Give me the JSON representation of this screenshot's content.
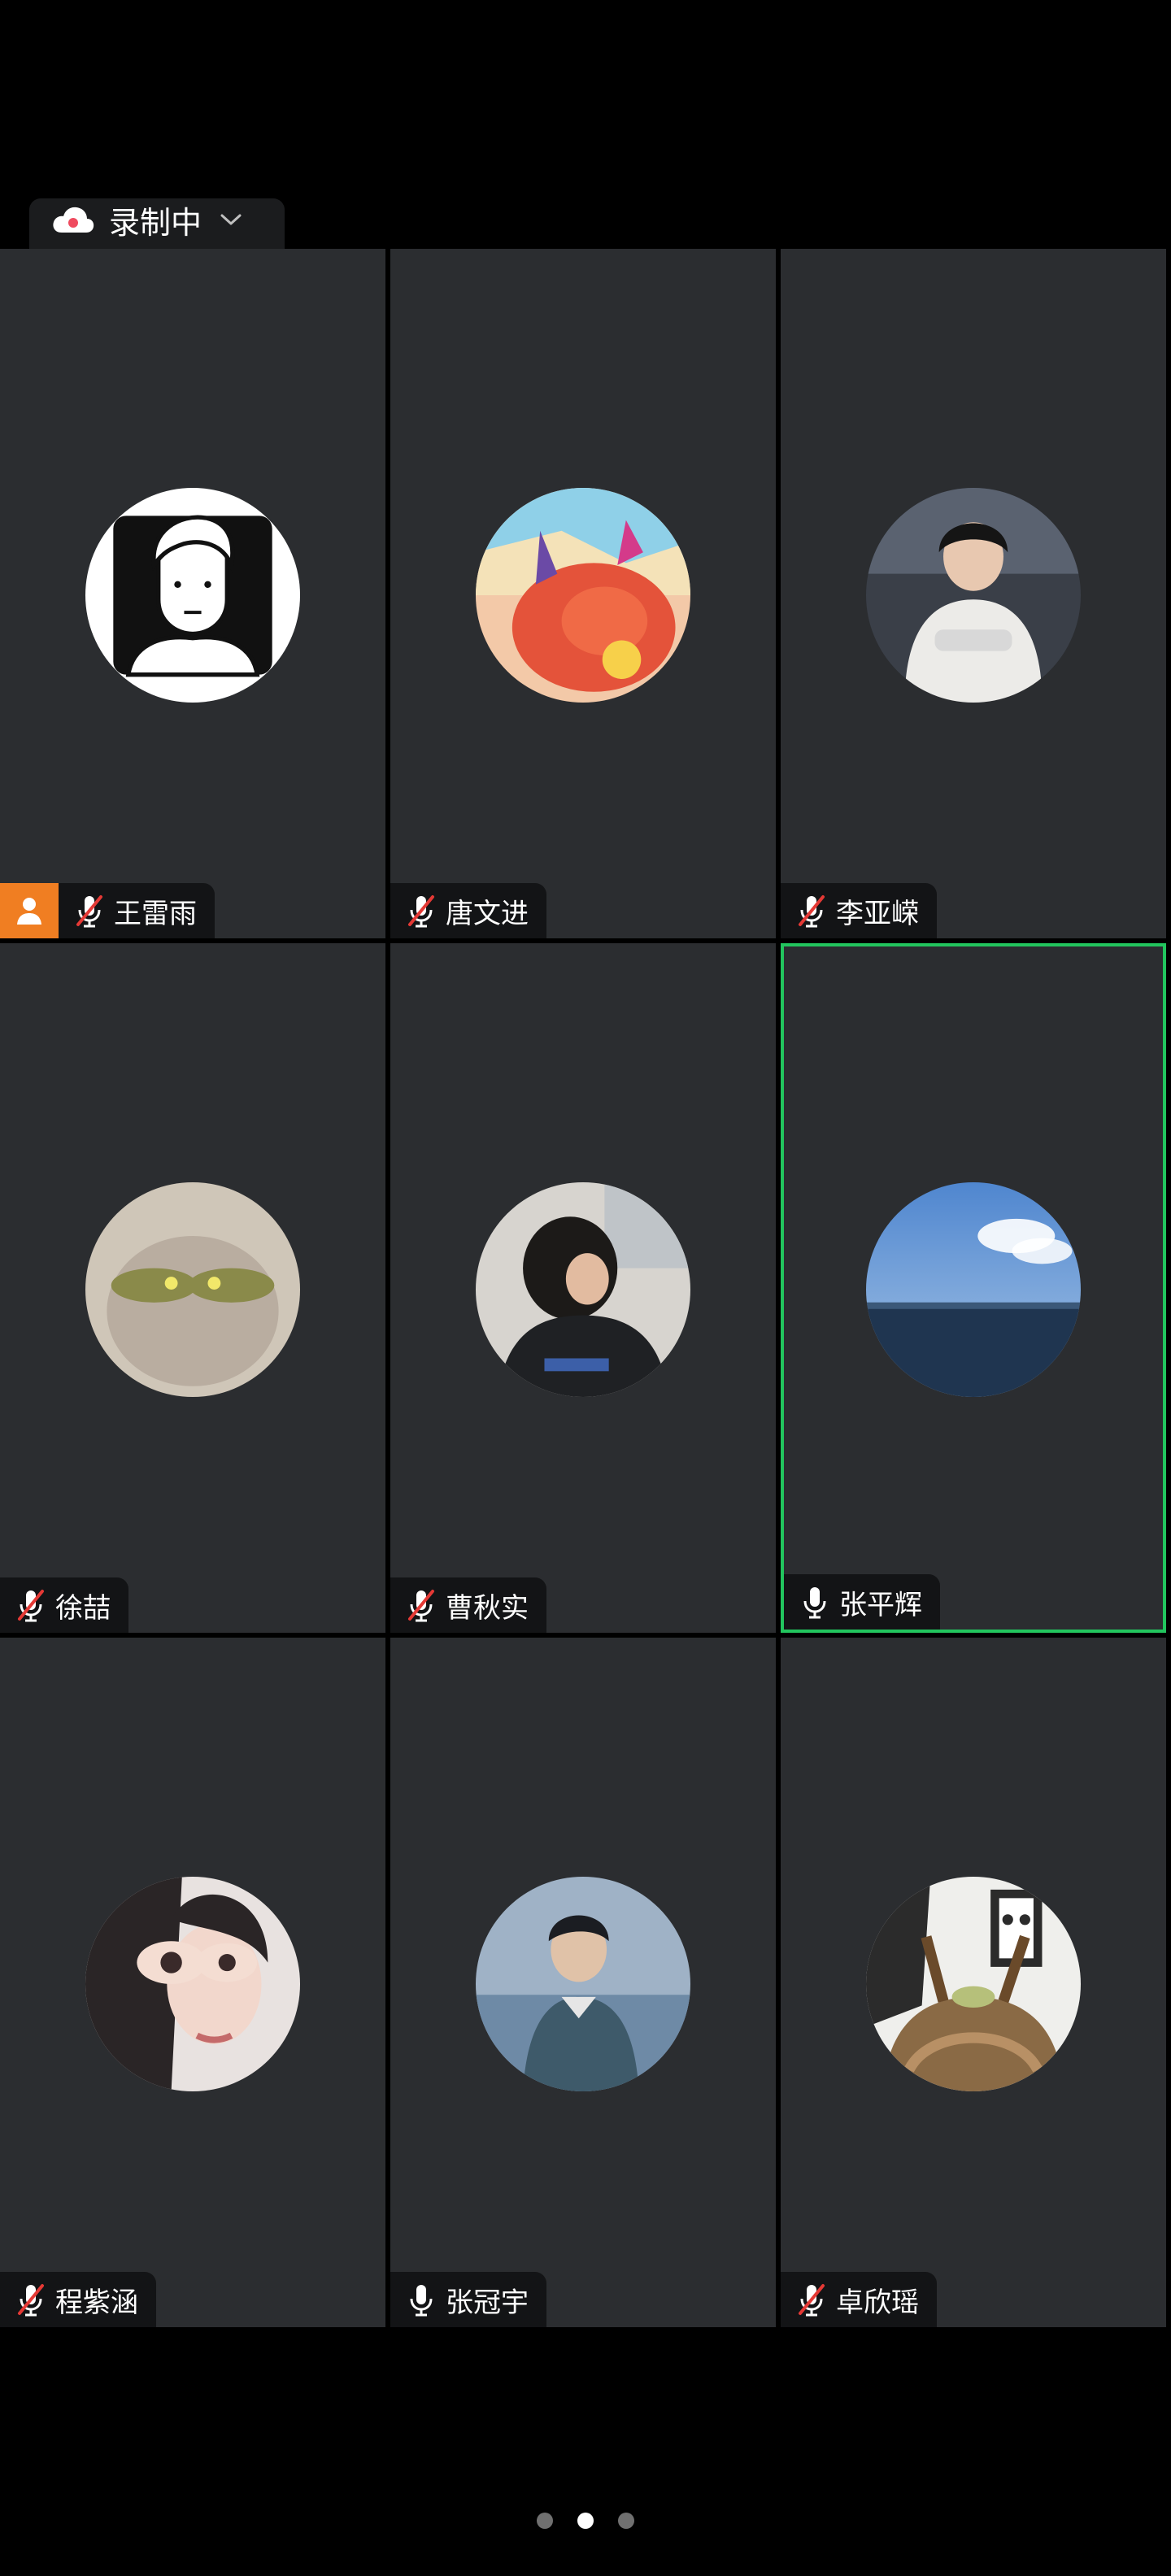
{
  "recording": {
    "label": "录制中",
    "icon": "cloud-recording-icon"
  },
  "participants": [
    {
      "name": "王雷雨",
      "mic": "muted",
      "host": true
    },
    {
      "name": "唐文进",
      "mic": "muted"
    },
    {
      "name": "李亚嵘",
      "mic": "muted"
    },
    {
      "name": "徐喆",
      "mic": "muted"
    },
    {
      "name": "曹秋实",
      "mic": "muted"
    },
    {
      "name": "张平辉",
      "mic": "on",
      "active_speaker": true
    },
    {
      "name": "程紫涵",
      "mic": "muted"
    },
    {
      "name": "张冠宇",
      "mic": "on"
    },
    {
      "name": "卓欣瑶",
      "mic": "muted"
    }
  ],
  "pagination": {
    "pages": 3,
    "current": 2
  },
  "colors": {
    "tile_bg": "#2b2d30",
    "active_border": "#22c55e",
    "host_badge": "#f07e22",
    "muted_slash": "#e53935"
  }
}
